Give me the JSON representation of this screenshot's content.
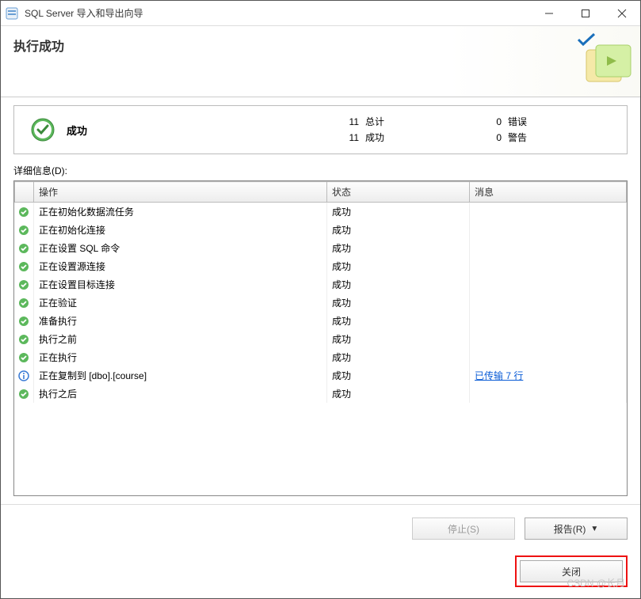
{
  "window": {
    "title": "SQL Server 导入和导出向导"
  },
  "header": {
    "title": "执行成功"
  },
  "summary": {
    "status_label": "成功",
    "total_count": "11",
    "total_label": "总计",
    "success_count": "11",
    "success_label": "成功",
    "error_count": "0",
    "error_label": "错误",
    "warning_count": "0",
    "warning_label": "警告"
  },
  "details": {
    "label": "详细信息(D):",
    "columns": {
      "action": "操作",
      "status": "状态",
      "message": "消息"
    },
    "rows": [
      {
        "icon": "success",
        "action": "正在初始化数据流任务",
        "status": "成功",
        "message": ""
      },
      {
        "icon": "success",
        "action": "正在初始化连接",
        "status": "成功",
        "message": ""
      },
      {
        "icon": "success",
        "action": "正在设置 SQL 命令",
        "status": "成功",
        "message": ""
      },
      {
        "icon": "success",
        "action": "正在设置源连接",
        "status": "成功",
        "message": ""
      },
      {
        "icon": "success",
        "action": "正在设置目标连接",
        "status": "成功",
        "message": ""
      },
      {
        "icon": "success",
        "action": "正在验证",
        "status": "成功",
        "message": ""
      },
      {
        "icon": "success",
        "action": "准备执行",
        "status": "成功",
        "message": ""
      },
      {
        "icon": "success",
        "action": "执行之前",
        "status": "成功",
        "message": ""
      },
      {
        "icon": "success",
        "action": "正在执行",
        "status": "成功",
        "message": ""
      },
      {
        "icon": "info",
        "action": "正在复制到 [dbo].[course]",
        "status": "成功",
        "message": "已传输 7 行",
        "link": true
      },
      {
        "icon": "success",
        "action": "执行之后",
        "status": "成功",
        "message": ""
      }
    ]
  },
  "buttons": {
    "stop": "停止(S)",
    "report": "报告(R)",
    "close": "关闭"
  },
  "watermark": "CSDN @长月"
}
